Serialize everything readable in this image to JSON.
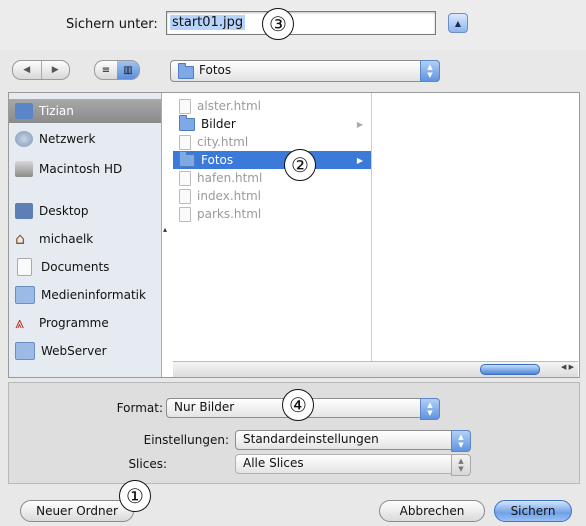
{
  "save_as": {
    "label": "Sichern unter:",
    "value": "start01.jpg"
  },
  "toolbar": {
    "back_glyph": "◀",
    "forward_glyph": "▶",
    "list_view_glyph": "≡",
    "column_view_glyph": "▥",
    "location": "Fotos"
  },
  "sidebar": {
    "items": [
      {
        "label": "Tizian",
        "icon": "computer-icon"
      },
      {
        "label": "Netzwerk",
        "icon": "network-icon"
      },
      {
        "label": "Macintosh HD",
        "icon": "hard-disk-icon"
      },
      {
        "label": "Desktop",
        "icon": "desktop-icon"
      },
      {
        "label": "michaelk",
        "icon": "home-icon"
      },
      {
        "label": "Documents",
        "icon": "document-icon"
      },
      {
        "label": "Medieninformatik",
        "icon": "folder-icon"
      },
      {
        "label": "Programme",
        "icon": "applications-icon"
      },
      {
        "label": "WebServer",
        "icon": "folder-icon"
      }
    ]
  },
  "columns": {
    "col1": [
      {
        "label": "alster.html",
        "type": "file"
      },
      {
        "label": "Bilder",
        "type": "folder"
      },
      {
        "label": "city.html",
        "type": "file"
      },
      {
        "label": "Fotos",
        "type": "folder"
      },
      {
        "label": "hafen.html",
        "type": "file"
      },
      {
        "label": "index.html",
        "type": "file"
      },
      {
        "label": "parks.html",
        "type": "file"
      }
    ]
  },
  "options": {
    "format_label": "Format:",
    "format_value": "Nur Bilder",
    "settings_label": "Einstellungen:",
    "settings_value": "Standardeinstellungen",
    "slices_label": "Slices:",
    "slices_value": "Alle Slices"
  },
  "buttons": {
    "new_folder": "Neuer Ordner",
    "cancel": "Abbrechen",
    "save": "Sichern"
  },
  "callouts": [
    "①",
    "②",
    "③",
    "④"
  ],
  "colors": {
    "selection": "#3b7ad9",
    "accent": "#6fa1e8"
  }
}
